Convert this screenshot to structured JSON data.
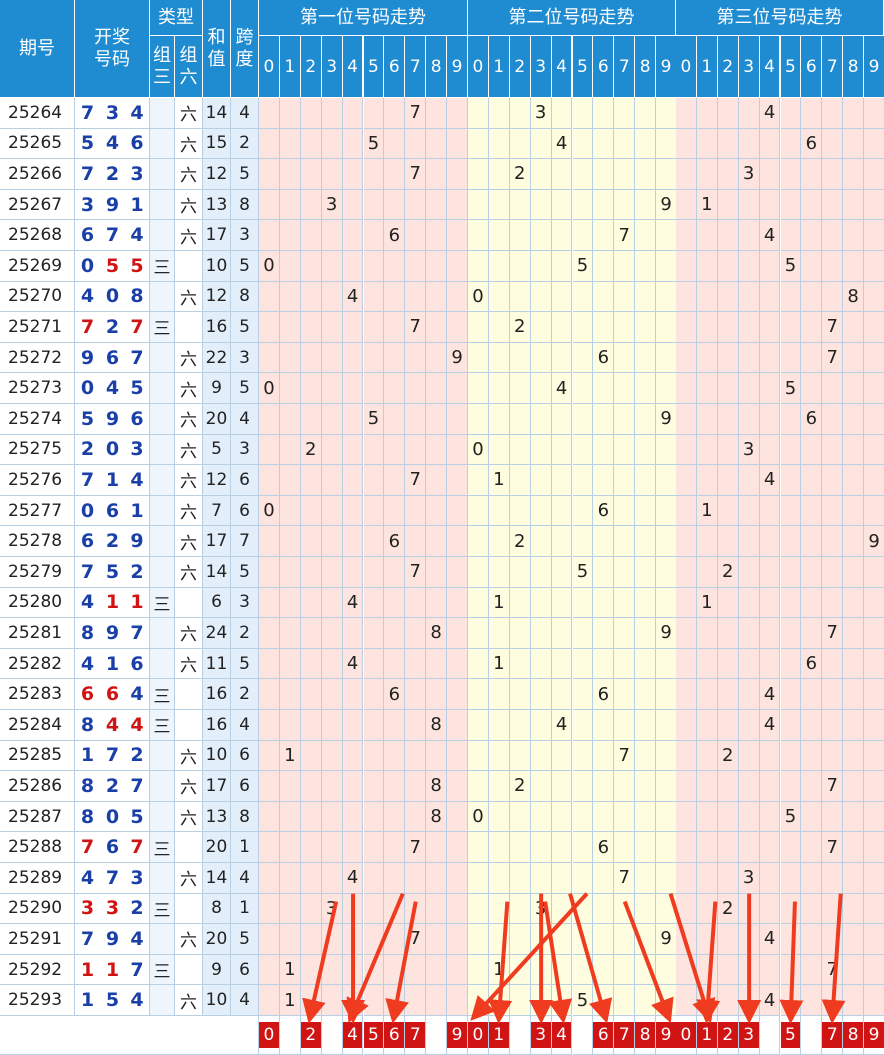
{
  "header": {
    "issue": "期号",
    "draw": "开奖\n号码",
    "type": "类型",
    "zu3": "组\n三",
    "zu6": "组\n六",
    "sum": "和\n值",
    "span": "跨\n度",
    "section1": "第一位号码走势",
    "section2": "第二位号码走势",
    "section3": "第三位号码走势",
    "digits": [
      "0",
      "1",
      "2",
      "3",
      "4",
      "5",
      "6",
      "7",
      "8",
      "9"
    ]
  },
  "labels": {
    "zu3": "三",
    "zu6": "六"
  },
  "colors": {
    "header_bg": "#1f8bd1",
    "draw_blue": "#1a3fa6",
    "draw_red": "#d01414",
    "pos1_bg": "#fde4de",
    "pos2_bg": "#fffde0",
    "pos3_bg": "#fde4de",
    "sum_bg": "#e3eefb",
    "tag_red": "#d01414",
    "arrow": "#ef3b1f"
  },
  "rows": [
    {
      "issue": "25264",
      "n": [
        7,
        3,
        4
      ],
      "type": "六",
      "sum": 14,
      "span": 4
    },
    {
      "issue": "25265",
      "n": [
        5,
        4,
        6
      ],
      "type": "六",
      "sum": 15,
      "span": 2
    },
    {
      "issue": "25266",
      "n": [
        7,
        2,
        3
      ],
      "type": "六",
      "sum": 12,
      "span": 5
    },
    {
      "issue": "25267",
      "n": [
        3,
        9,
        1
      ],
      "type": "六",
      "sum": 13,
      "span": 8
    },
    {
      "issue": "25268",
      "n": [
        6,
        7,
        4
      ],
      "type": "六",
      "sum": 17,
      "span": 3
    },
    {
      "issue": "25269",
      "n": [
        0,
        5,
        5
      ],
      "type": "三",
      "sum": 10,
      "span": 5
    },
    {
      "issue": "25270",
      "n": [
        4,
        0,
        8
      ],
      "type": "六",
      "sum": 12,
      "span": 8
    },
    {
      "issue": "25271",
      "n": [
        7,
        2,
        7
      ],
      "type": "三",
      "sum": 16,
      "span": 5
    },
    {
      "issue": "25272",
      "n": [
        9,
        6,
        7
      ],
      "type": "六",
      "sum": 22,
      "span": 3
    },
    {
      "issue": "25273",
      "n": [
        0,
        4,
        5
      ],
      "type": "六",
      "sum": 9,
      "span": 5
    },
    {
      "issue": "25274",
      "n": [
        5,
        9,
        6
      ],
      "type": "六",
      "sum": 20,
      "span": 4
    },
    {
      "issue": "25275",
      "n": [
        2,
        0,
        3
      ],
      "type": "六",
      "sum": 5,
      "span": 3
    },
    {
      "issue": "25276",
      "n": [
        7,
        1,
        4
      ],
      "type": "六",
      "sum": 12,
      "span": 6
    },
    {
      "issue": "25277",
      "n": [
        0,
        6,
        1
      ],
      "type": "六",
      "sum": 7,
      "span": 6
    },
    {
      "issue": "25278",
      "n": [
        6,
        2,
        9
      ],
      "type": "六",
      "sum": 17,
      "span": 7
    },
    {
      "issue": "25279",
      "n": [
        7,
        5,
        2
      ],
      "type": "六",
      "sum": 14,
      "span": 5
    },
    {
      "issue": "25280",
      "n": [
        4,
        1,
        1
      ],
      "type": "三",
      "sum": 6,
      "span": 3
    },
    {
      "issue": "25281",
      "n": [
        8,
        9,
        7
      ],
      "type": "六",
      "sum": 24,
      "span": 2
    },
    {
      "issue": "25282",
      "n": [
        4,
        1,
        6
      ],
      "type": "六",
      "sum": 11,
      "span": 5
    },
    {
      "issue": "25283",
      "n": [
        6,
        6,
        4
      ],
      "type": "三",
      "sum": 16,
      "span": 2
    },
    {
      "issue": "25284",
      "n": [
        8,
        4,
        4
      ],
      "type": "三",
      "sum": 16,
      "span": 4
    },
    {
      "issue": "25285",
      "n": [
        1,
        7,
        2
      ],
      "type": "六",
      "sum": 10,
      "span": 6
    },
    {
      "issue": "25286",
      "n": [
        8,
        2,
        7
      ],
      "type": "六",
      "sum": 17,
      "span": 6
    },
    {
      "issue": "25287",
      "n": [
        8,
        0,
        5
      ],
      "type": "六",
      "sum": 13,
      "span": 8
    },
    {
      "issue": "25288",
      "n": [
        7,
        6,
        7
      ],
      "type": "三",
      "sum": 20,
      "span": 1
    },
    {
      "issue": "25289",
      "n": [
        4,
        7,
        3
      ],
      "type": "六",
      "sum": 14,
      "span": 4
    },
    {
      "issue": "25290",
      "n": [
        3,
        3,
        2
      ],
      "type": "三",
      "sum": 8,
      "span": 1
    },
    {
      "issue": "25291",
      "n": [
        7,
        9,
        4
      ],
      "type": "六",
      "sum": 20,
      "span": 5
    },
    {
      "issue": "25292",
      "n": [
        1,
        1,
        7
      ],
      "type": "三",
      "sum": 9,
      "span": 6
    },
    {
      "issue": "25293",
      "n": [
        1,
        5,
        4
      ],
      "type": "六",
      "sum": 10,
      "span": 4
    }
  ],
  "prediction": [
    [
      "0",
      "",
      "2",
      "",
      "4",
      "5",
      "6",
      "7",
      "",
      "9"
    ],
    [
      "0",
      "1",
      "",
      "3",
      "4",
      "",
      "6",
      "7",
      "8",
      "9"
    ],
    [
      "0",
      "1",
      "2",
      "3",
      "",
      "5",
      "",
      "7",
      "8",
      "9"
    ]
  ],
  "arrows": [
    [
      1,
      4,
      "p",
      0,
      4
    ],
    [
      1,
      3,
      "p",
      0,
      2
    ],
    [
      1,
      6,
      "p",
      0,
      4
    ],
    [
      1,
      7,
      "p",
      0,
      6
    ],
    [
      2,
      5,
      "p",
      1,
      0
    ],
    [
      2,
      1,
      "p",
      1,
      1
    ],
    [
      2,
      3,
      "p",
      1,
      3
    ],
    [
      2,
      3,
      "p",
      1,
      4
    ],
    [
      2,
      4,
      "p",
      1,
      6
    ],
    [
      2,
      7,
      "p",
      1,
      9
    ],
    [
      2,
      9,
      "p",
      2,
      1
    ],
    [
      3,
      1,
      "p",
      2,
      1
    ],
    [
      3,
      3,
      "p",
      2,
      3
    ],
    [
      3,
      5,
      "p",
      2,
      5
    ],
    [
      3,
      7,
      "p",
      2,
      7
    ]
  ]
}
